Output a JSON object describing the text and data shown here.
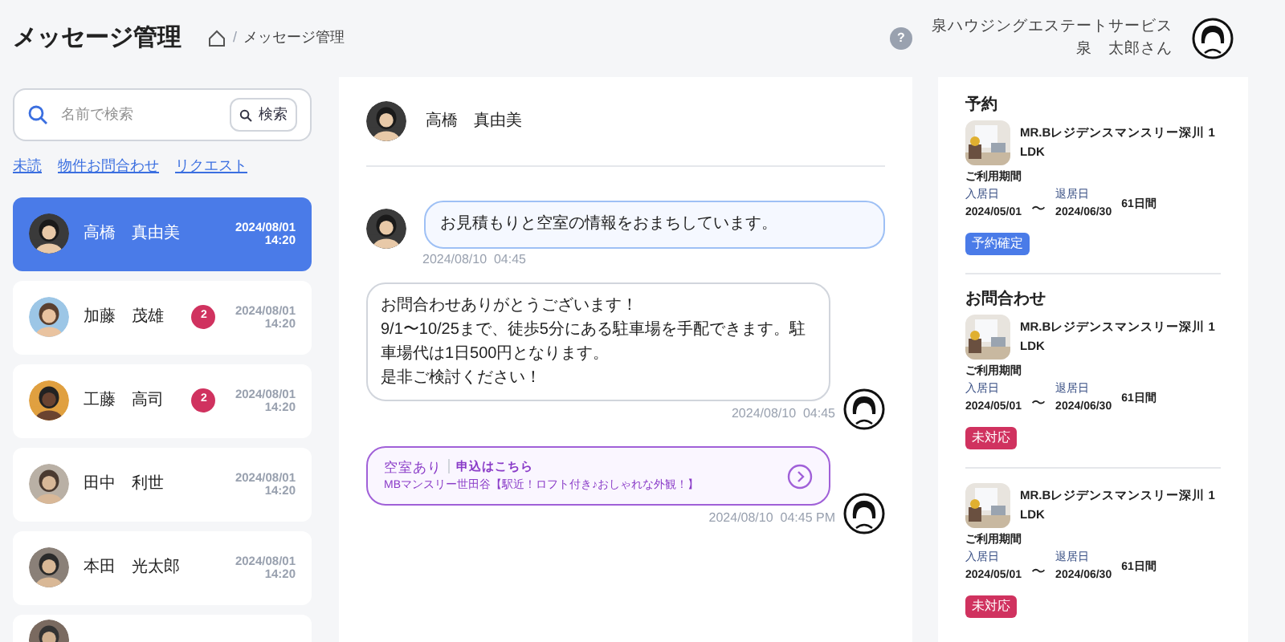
{
  "page_title": "メッセージ管理",
  "breadcrumb": {
    "separator": "/",
    "current": "メッセージ管理"
  },
  "account": {
    "company": "泉ハウジングエステートサービス",
    "user": "泉　太郎さん",
    "help": "?"
  },
  "search": {
    "placeholder": "名前で検索",
    "button": "検索"
  },
  "filters": [
    {
      "label": "未読"
    },
    {
      "label": "物件お問合わせ"
    },
    {
      "label": "リクエスト"
    }
  ],
  "contacts": [
    {
      "name": "高橋　真由美",
      "date": "2024/08/01",
      "time": "14:20",
      "selected": true
    },
    {
      "name": "加藤　茂雄",
      "badge": "2",
      "date": "2024/08/01",
      "time": "14:20",
      "selected": false
    },
    {
      "name": "工藤　高司",
      "badge": "2",
      "date": "2024/08/01",
      "time": "14:20",
      "selected": false
    },
    {
      "name": "田中　利世",
      "date": "2024/08/01",
      "time": "14:20",
      "selected": false
    },
    {
      "name": "本田　光太郎",
      "date": "2024/08/01",
      "time": "14:20",
      "selected": false
    }
  ],
  "chat": {
    "name": "高橋　真由美",
    "messages": [
      {
        "kind": "incoming",
        "text": "お見積もりと空室の情報をおまちしています。",
        "time": "2024/08/10  04:45"
      },
      {
        "kind": "outgoing",
        "lines": [
          "お問合わせありがとうございます！",
          "9/1〜10/25まで、徒歩5分にある駐車場を手配できます。駐車場代は1日500円となります。",
          "是非ご検討ください！"
        ],
        "time": "2024/08/10  04:45"
      },
      {
        "kind": "link_card",
        "status": "空室あり",
        "action": "申込はこちら",
        "property": "MBマンスリー世田谷【駅近！ロフト付き♪おしゃれな外観！】",
        "time": "2024/08/10  04:45 PM"
      }
    ]
  },
  "sidebar_sections": [
    {
      "title": "予約",
      "items": [
        {
          "property": "MR.Bレジデンスマンスリー深川 1 LDK",
          "period_label": "ご利用期間",
          "move_in_label": "入居日",
          "move_in": "2024/05/01",
          "tilde": "〜",
          "move_out_label": "退居日",
          "move_out": "2024/06/30",
          "duration": "61日間",
          "status": "予約確定",
          "kind": "confirmed"
        }
      ]
    },
    {
      "title": "お問合わせ",
      "items": [
        {
          "property": "MR.Bレジデンスマンスリー深川 1 LDK",
          "period_label": "ご利用期間",
          "move_in_label": "入居日",
          "move_in": "2024/05/01",
          "tilde": "〜",
          "move_out_label": "退居日",
          "move_out": "2024/06/30",
          "duration": "61日間",
          "status": "未対応",
          "kind": "pending"
        },
        {
          "property": "MR.Bレジデンスマンスリー深川 1 LDK",
          "period_label": "ご利用期間",
          "move_in_label": "入居日",
          "move_in": "2024/05/01",
          "tilde": "〜",
          "move_out_label": "退居日",
          "move_out": "2024/06/30",
          "duration": "61日間",
          "status": "未対応",
          "kind": "pending"
        }
      ]
    }
  ]
}
